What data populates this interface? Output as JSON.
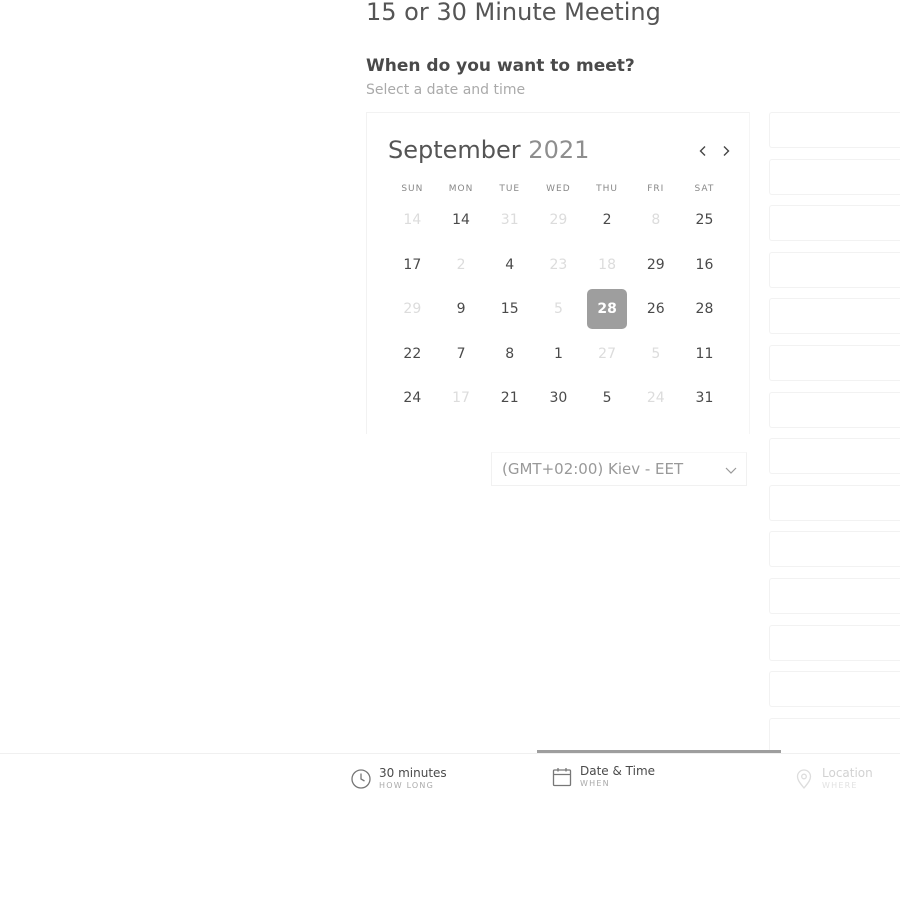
{
  "meeting": {
    "title": "15 or 30 Minute Meeting",
    "question": "When do you want to meet?",
    "subtitle": "Select a date and time"
  },
  "calendar": {
    "month": "September",
    "year": "2021",
    "weekdays": [
      "SUN",
      "MON",
      "TUE",
      "WED",
      "THU",
      "FRI",
      "SAT"
    ],
    "days": [
      {
        "label": "14",
        "disabled": true
      },
      {
        "label": "14",
        "disabled": false
      },
      {
        "label": "31",
        "disabled": true
      },
      {
        "label": "29",
        "disabled": true
      },
      {
        "label": "2",
        "disabled": false
      },
      {
        "label": "8",
        "disabled": true
      },
      {
        "label": "25",
        "disabled": false
      },
      {
        "label": "17",
        "disabled": false
      },
      {
        "label": "2",
        "disabled": true
      },
      {
        "label": "4",
        "disabled": false
      },
      {
        "label": "23",
        "disabled": true
      },
      {
        "label": "18",
        "disabled": true
      },
      {
        "label": "29",
        "disabled": false
      },
      {
        "label": "16",
        "disabled": false
      },
      {
        "label": "29",
        "disabled": true
      },
      {
        "label": "9",
        "disabled": false
      },
      {
        "label": "15",
        "disabled": false
      },
      {
        "label": "5",
        "disabled": true
      },
      {
        "label": "28",
        "disabled": false,
        "selected": true
      },
      {
        "label": "26",
        "disabled": false
      },
      {
        "label": "28",
        "disabled": false
      },
      {
        "label": "22",
        "disabled": false
      },
      {
        "label": "7",
        "disabled": false
      },
      {
        "label": "8",
        "disabled": false
      },
      {
        "label": "1",
        "disabled": false
      },
      {
        "label": "27",
        "disabled": true
      },
      {
        "label": "5",
        "disabled": true
      },
      {
        "label": "11",
        "disabled": false
      },
      {
        "label": "24",
        "disabled": false
      },
      {
        "label": "17",
        "disabled": true
      },
      {
        "label": "21",
        "disabled": false
      },
      {
        "label": "30",
        "disabled": false
      },
      {
        "label": "5",
        "disabled": false
      },
      {
        "label": "24",
        "disabled": true
      },
      {
        "label": "31",
        "disabled": false
      }
    ],
    "prev_icon": "chevron-left-icon",
    "next_icon": "chevron-right-icon"
  },
  "timezone": {
    "value": "(GMT+02:00) Kiev - EET",
    "icon": "chevron-down-icon"
  },
  "time_slots": {
    "count_visible": 14
  },
  "steps": [
    {
      "label": "30 minutes",
      "sub": "HOW LONG",
      "icon": "clock-icon",
      "active": false
    },
    {
      "label": "Date & Time",
      "sub": "WHEN",
      "icon": "calendar-icon",
      "active": true
    },
    {
      "label": "Location",
      "sub": "WHERE",
      "icon": "location-pin-icon",
      "active": false
    }
  ],
  "colors": {
    "selected_day": "#9e9e9e",
    "active_step_bar": "#9e9e9e",
    "disabled_text": "#dcdcdc"
  }
}
